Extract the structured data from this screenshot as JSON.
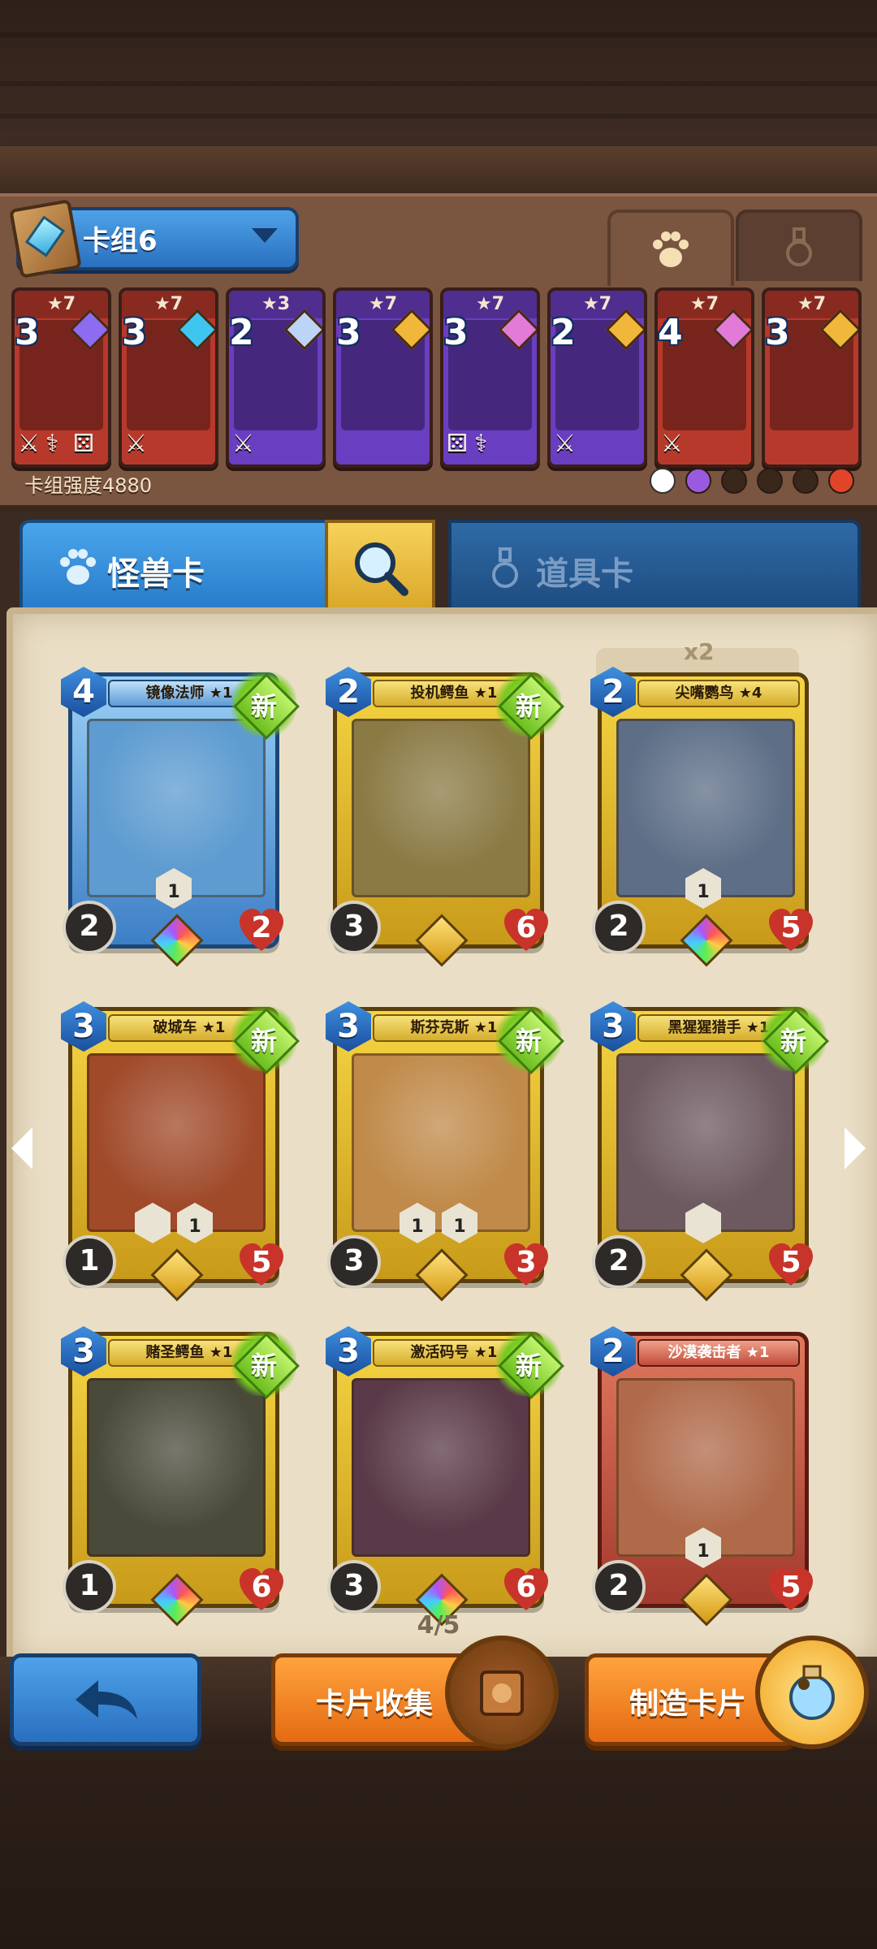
{
  "deck": {
    "title": "卡组6",
    "strength": "卡组强度4880",
    "tabs": [
      {
        "icon": "paw-icon",
        "active": true
      },
      {
        "icon": "potion-icon",
        "active": false
      }
    ],
    "cards": [
      {
        "stars": "★7",
        "cost": "3",
        "color": "#b7392c",
        "rarity": "#8e6cf0",
        "tags": [
          "sword-icon",
          "staff-icon",
          "dice-icon"
        ]
      },
      {
        "stars": "★7",
        "cost": "3",
        "color": "#b7392c",
        "rarity": "#3ec6f0",
        "tags": [
          "sword-icon"
        ]
      },
      {
        "stars": "★3",
        "cost": "2",
        "color": "#6a3ec0",
        "rarity": "#bcd4f5",
        "tags": [
          "sword-icon"
        ]
      },
      {
        "stars": "★7",
        "cost": "3",
        "color": "#6a3ec0",
        "rarity": "#f0b73a",
        "tags": []
      },
      {
        "stars": "★7",
        "cost": "3",
        "color": "#6a3ec0",
        "rarity": "#e27ad8",
        "tags": [
          "dice-icon",
          "staff-icon"
        ]
      },
      {
        "stars": "★7",
        "cost": "2",
        "color": "#6a3ec0",
        "rarity": "#f0b73a",
        "tags": [
          "sword-icon"
        ]
      },
      {
        "stars": "★7",
        "cost": "4",
        "color": "#b7392c",
        "rarity": "#e27ad8",
        "tags": [
          "sword-icon"
        ]
      },
      {
        "stars": "★7",
        "cost": "3",
        "color": "#b7392c",
        "rarity": "#f0b73a",
        "tags": []
      }
    ]
  },
  "categories": {
    "monster_label": "怪兽卡",
    "item_label": "道具卡"
  },
  "collection": {
    "stack_label": "x2",
    "page": "4/5",
    "cards": [
      {
        "name": "镜像法师 ★1",
        "cost": "4",
        "atk": "2",
        "hp": "2",
        "style": "blue",
        "new": "新",
        "art": "#5d9bd0",
        "gem": "rainbow",
        "abilities": [
          "1"
        ]
      },
      {
        "name": "投机鳄鱼 ★1",
        "cost": "2",
        "atk": "3",
        "hp": "6",
        "style": "gold",
        "new": "新",
        "art": "#8a7a44",
        "gem": "gold",
        "abilities": []
      },
      {
        "name": "尖嘴鹦鸟 ★4",
        "cost": "2",
        "atk": "2",
        "hp": "5",
        "style": "gold",
        "new": "",
        "art": "#5d6e86",
        "gem": "rainbow",
        "abilities": [
          "1"
        ]
      },
      {
        "name": "破城车 ★1",
        "cost": "3",
        "atk": "1",
        "hp": "5",
        "style": "gold",
        "new": "新",
        "art": "#a04a2a",
        "gem": "gold",
        "abilities": [
          "",
          "1"
        ]
      },
      {
        "name": "斯芬克斯 ★1",
        "cost": "3",
        "atk": "3",
        "hp": "3",
        "style": "gold",
        "new": "新",
        "art": "#c08a4a",
        "gem": "gold",
        "abilities": [
          "1",
          "1"
        ]
      },
      {
        "name": "黑猩猩猎手 ★1",
        "cost": "3",
        "atk": "2",
        "hp": "5",
        "style": "gold",
        "new": "新",
        "art": "#6d5a60",
        "gem": "gold",
        "abilities": [
          ""
        ]
      },
      {
        "name": "赌圣鳄鱼 ★1",
        "cost": "3",
        "atk": "1",
        "hp": "6",
        "style": "gold",
        "new": "新",
        "art": "#4a4a3a",
        "gem": "rainbow",
        "abilities": []
      },
      {
        "name": "激活码号 ★1",
        "cost": "3",
        "atk": "3",
        "hp": "6",
        "style": "gold",
        "new": "新",
        "art": "#5a3a48",
        "gem": "rainbow",
        "abilities": []
      },
      {
        "name": "沙漠袭击者 ★1",
        "cost": "2",
        "atk": "2",
        "hp": "5",
        "style": "red",
        "new": "",
        "art": "#b06a4a",
        "gem": "gold",
        "abilities": [
          "1"
        ]
      }
    ]
  },
  "bottom": {
    "collect_label": "卡片收集",
    "craft_label": "制造卡片"
  }
}
